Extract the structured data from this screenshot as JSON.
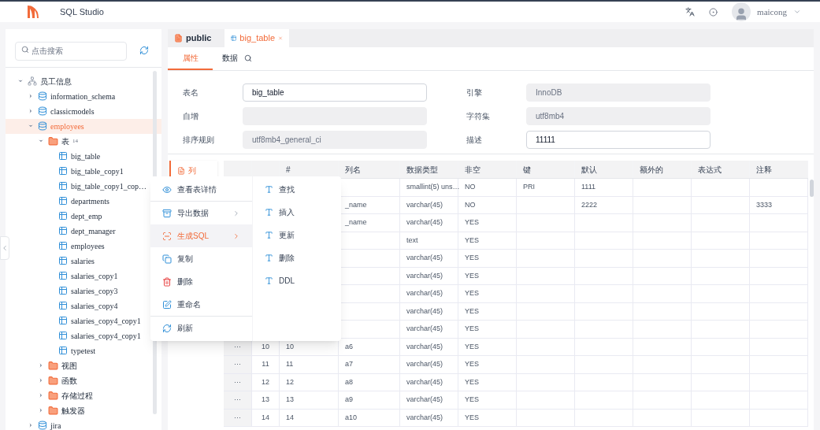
{
  "header": {
    "app_title": "SQL Studio",
    "user_name": "maicong"
  },
  "sidebar": {
    "search": {
      "placeholder": "点击搜索"
    },
    "tree": [
      {
        "label": "员工信息",
        "kind": "connection",
        "expanded": true,
        "selected": false,
        "children": [
          {
            "label": "information_schema",
            "kind": "database",
            "expanded": false,
            "selected": false
          },
          {
            "label": "classicmodels",
            "kind": "database",
            "expanded": false,
            "selected": false
          },
          {
            "label": "employees",
            "kind": "database",
            "expanded": true,
            "selected": true,
            "children": [
              {
                "label": "表",
                "count": "14",
                "kind": "folder",
                "expanded": true,
                "selected": false,
                "children": [
                  {
                    "label": "big_table",
                    "kind": "table",
                    "selected": false
                  },
                  {
                    "label": "big_table_copy1",
                    "kind": "table",
                    "selected": false
                  },
                  {
                    "label": "big_table_copy1_cop…",
                    "kind": "table",
                    "selected": false
                  },
                  {
                    "label": "departments",
                    "kind": "table",
                    "selected": false
                  },
                  {
                    "label": "dept_emp",
                    "kind": "table",
                    "selected": false
                  },
                  {
                    "label": "dept_manager",
                    "kind": "table",
                    "selected": false
                  },
                  {
                    "label": "employees",
                    "kind": "table",
                    "selected": false
                  },
                  {
                    "label": "salaries",
                    "kind": "table",
                    "selected": false
                  },
                  {
                    "label": "salaries_copy1",
                    "kind": "table",
                    "selected": false
                  },
                  {
                    "label": "salaries_copy3",
                    "kind": "table",
                    "selected": false
                  },
                  {
                    "label": "salaries_copy4",
                    "kind": "table",
                    "selected": false
                  },
                  {
                    "label": "salaries_copy4_copy1",
                    "kind": "table",
                    "selected": false
                  },
                  {
                    "label": "salaries_copy4_copy1",
                    "kind": "table",
                    "selected": false
                  },
                  {
                    "label": "typetest",
                    "kind": "table",
                    "selected": false
                  }
                ]
              },
              {
                "label": "视图",
                "kind": "folder",
                "expanded": false,
                "selected": false
              },
              {
                "label": "函数",
                "kind": "folder",
                "expanded": false,
                "selected": false
              },
              {
                "label": "存储过程",
                "kind": "folder",
                "expanded": false,
                "selected": false
              },
              {
                "label": "触发器",
                "kind": "folder",
                "expanded": false,
                "selected": false
              }
            ]
          },
          {
            "label": "jira",
            "kind": "database",
            "expanded": false,
            "selected": false
          }
        ]
      }
    ]
  },
  "tabs": [
    {
      "label": "public",
      "kind": "schema",
      "selected": false,
      "closable": false
    },
    {
      "label": "big_table",
      "kind": "table",
      "selected": true,
      "closable": true
    }
  ],
  "subtabs": [
    {
      "label": "属性",
      "selected": true,
      "searchable": false
    },
    {
      "label": "数据",
      "selected": false,
      "searchable": true
    }
  ],
  "form": {
    "left": [
      {
        "label": "表名",
        "value": "big_table",
        "disabled": false
      },
      {
        "label": "自增",
        "disabled": true
      },
      {
        "label": "排序规则",
        "value": "utf8mb4_general_ci",
        "disabled": true
      }
    ],
    "right": [
      {
        "label": "引擎",
        "value": "InnoDB",
        "disabled": true
      },
      {
        "label": "字符集",
        "value": "utf8mb4",
        "disabled": true
      },
      {
        "label": "描述",
        "value": "11111",
        "disabled": false
      }
    ]
  },
  "section_nav": [
    {
      "label": "列",
      "selected": true
    }
  ],
  "table": {
    "columns": [
      "#",
      "列名",
      "数据类型",
      "非空",
      "键",
      "默认",
      "额外的",
      "表达式",
      "注释"
    ],
    "rows": [
      {
        "type": "smallint(5) uns…",
        "not_null": "NO",
        "key": "PRI",
        "default": "1111"
      },
      {
        "name": "_name",
        "type": "varchar(45)",
        "not_null": "NO",
        "default": "2222",
        "comment": "3333"
      },
      {
        "name": "_name",
        "type": "varchar(45)",
        "not_null": "YES"
      },
      {
        "type": "text",
        "not_null": "YES"
      },
      {
        "type": "varchar(45)",
        "not_null": "YES"
      },
      {
        "type": "varchar(45)",
        "not_null": "YES"
      },
      {
        "type": "varchar(45)",
        "not_null": "YES"
      },
      {
        "type": "varchar(45)",
        "not_null": "YES"
      },
      {
        "type": "varchar(45)",
        "not_null": "YES"
      },
      {
        "menu": "···",
        "index": "10",
        "number": "10",
        "name": "a6",
        "type": "varchar(45)",
        "not_null": "YES"
      },
      {
        "menu": "···",
        "index": "11",
        "number": "11",
        "name": "a7",
        "type": "varchar(45)",
        "not_null": "YES"
      },
      {
        "menu": "···",
        "index": "12",
        "number": "12",
        "name": "a8",
        "type": "varchar(45)",
        "not_null": "YES"
      },
      {
        "menu": "···",
        "index": "13",
        "number": "13",
        "name": "a9",
        "type": "varchar(45)",
        "not_null": "YES"
      },
      {
        "menu": "···",
        "index": "14",
        "number": "14",
        "name": "a10",
        "type": "varchar(45)",
        "not_null": "YES"
      }
    ]
  },
  "context_menu": {
    "groups": [
      [
        {
          "label": "查看表详情",
          "kind": "view",
          "submenu": false,
          "selected": false
        }
      ],
      [
        {
          "label": "导出数据",
          "kind": "export",
          "submenu": true,
          "selected": false
        },
        {
          "label": "生成SQL",
          "kind": "sql",
          "submenu": true,
          "selected": true
        },
        {
          "label": "复制",
          "kind": "copy",
          "submenu": false,
          "selected": false
        },
        {
          "label": "删除",
          "kind": "delete",
          "submenu": false,
          "selected": false
        },
        {
          "label": "重命名",
          "kind": "rename",
          "submenu": false,
          "selected": false
        }
      ],
      [
        {
          "label": "刷新",
          "kind": "refresh",
          "submenu": false,
          "selected": false
        }
      ]
    ],
    "submenu": [
      "查找",
      "插入",
      "更新",
      "删除",
      "DDL"
    ]
  }
}
